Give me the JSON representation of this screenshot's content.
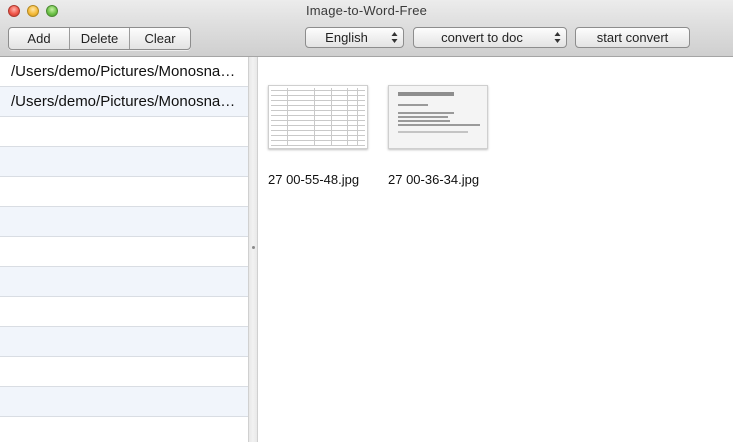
{
  "window": {
    "title": "Image-to-Word-Free"
  },
  "toolbar": {
    "add_label": "Add",
    "delete_label": "Delete",
    "clear_label": "Clear",
    "language_selected": "English",
    "format_selected": "convert to doc",
    "start_label": "start convert"
  },
  "files": [
    {
      "path": "/Users/demo/Pictures/Monosnap/..."
    },
    {
      "path": "/Users/demo/Pictures/Monosnap/..."
    }
  ],
  "thumbnails": [
    {
      "caption": "27 00-55-48.jpg"
    },
    {
      "caption": "27 00-36-34.jpg"
    }
  ],
  "colors": {
    "row_alt": "#f1f5fb",
    "row_border": "#d9dde3",
    "close": "#f0574a",
    "minimize": "#f5bb3a",
    "zoom": "#6cc247"
  }
}
